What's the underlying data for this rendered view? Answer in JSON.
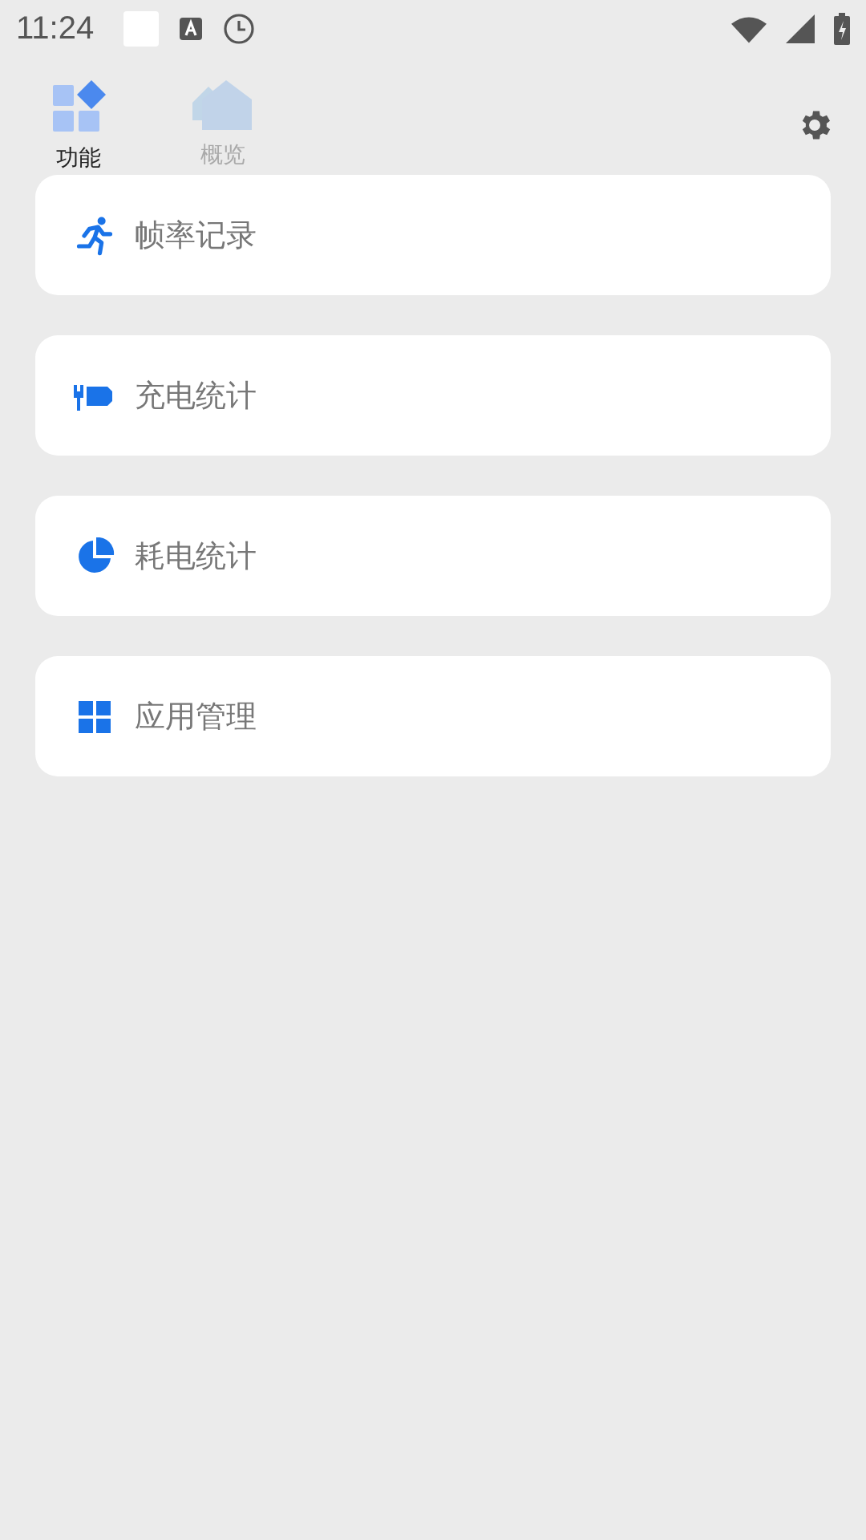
{
  "status_bar": {
    "time": "11:24"
  },
  "tabs": [
    {
      "label": "功能",
      "kind": "functions",
      "selected": true
    },
    {
      "label": "概览",
      "kind": "overview",
      "selected": false
    }
  ],
  "items": [
    {
      "label": "帧率记录",
      "kind": "runner"
    },
    {
      "label": "充电统计",
      "kind": "charging"
    },
    {
      "label": "耗电统计",
      "kind": "pie"
    },
    {
      "label": "应用管理",
      "kind": "grid"
    }
  ]
}
